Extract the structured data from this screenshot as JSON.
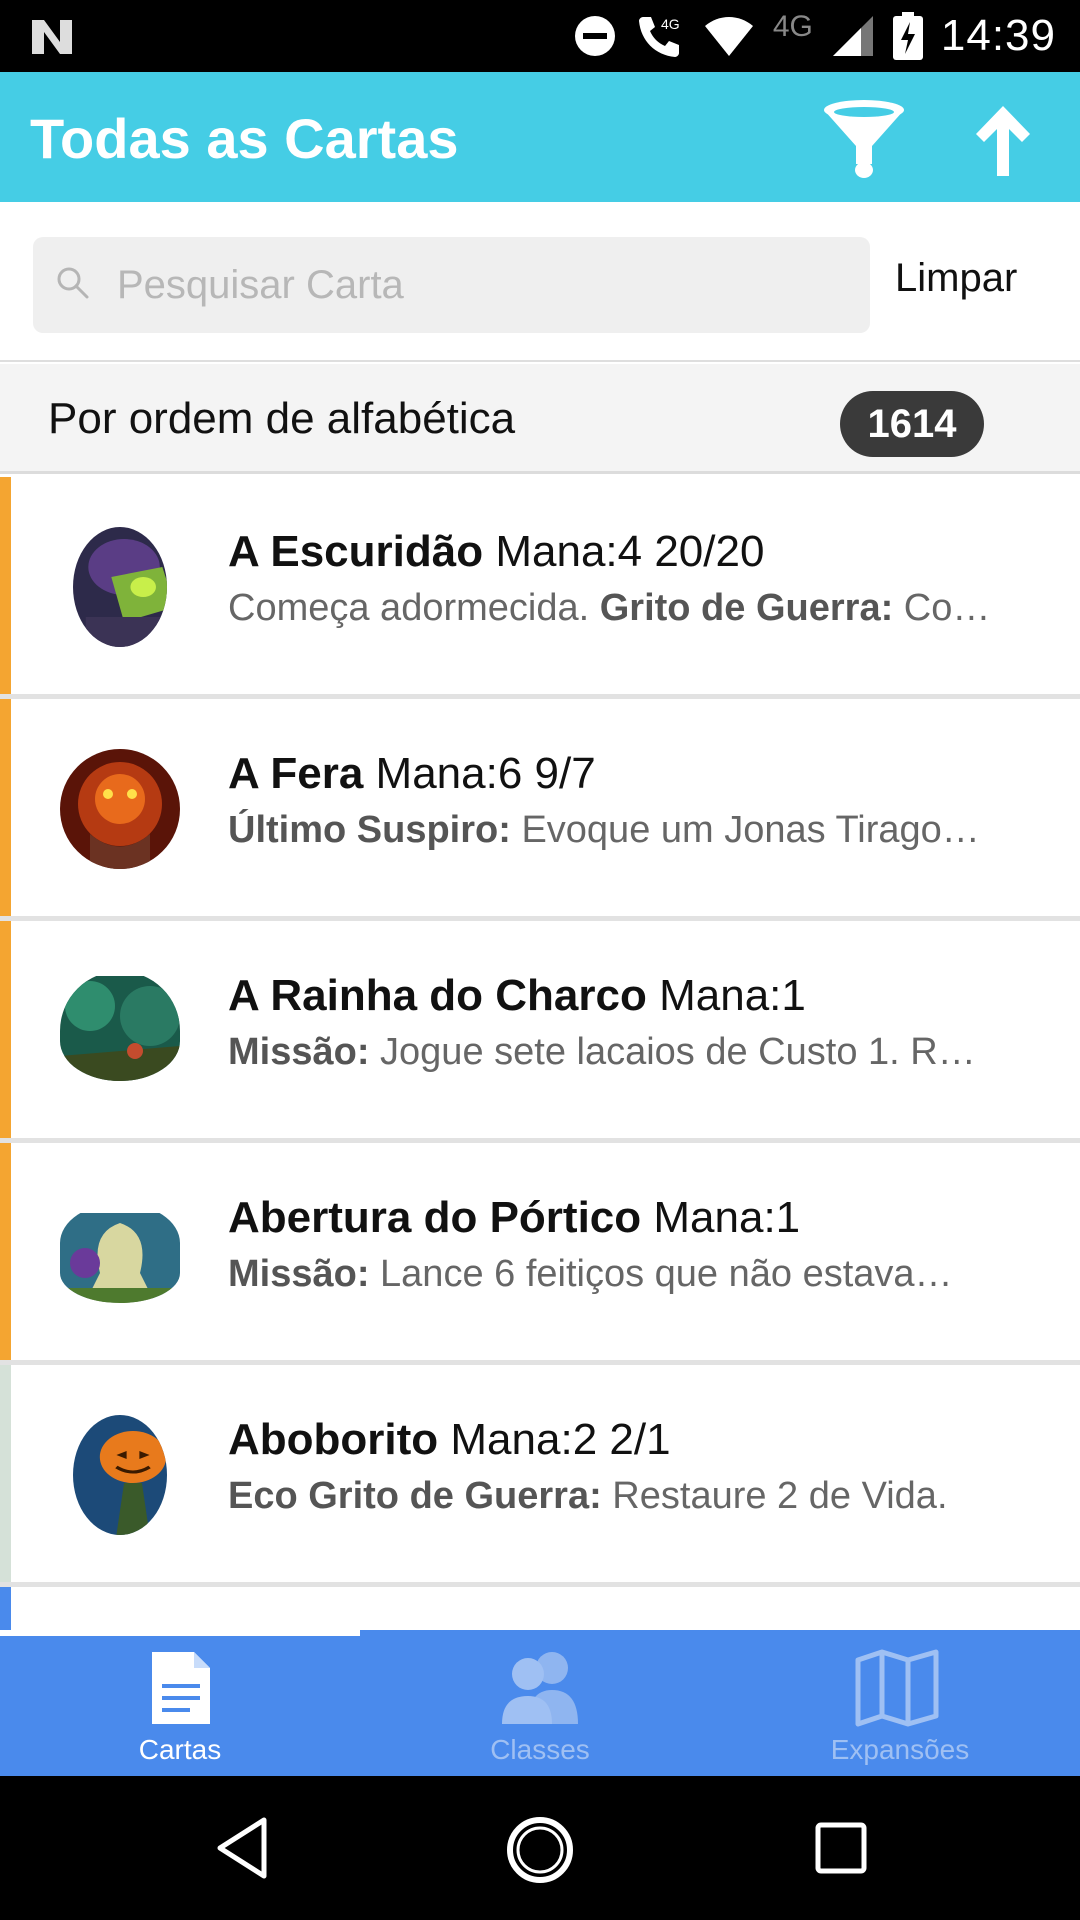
{
  "status_bar": {
    "network_label": "4G",
    "call_badge": "4G",
    "time": "14:39"
  },
  "app_bar": {
    "title": "Todas as Cartas",
    "icons": [
      "filter-icon",
      "arrow-up-icon"
    ]
  },
  "search": {
    "placeholder": "Pesquisar Carta",
    "value": "",
    "clear_label": "Limpar"
  },
  "sort_header": {
    "label": "Por ordem de alfabética",
    "count": "1614"
  },
  "cards": [
    {
      "name": "A Escuridão",
      "stats": "Mana:4 20/20",
      "desc_bold": "",
      "desc_prefix": "Começa adormecida. ",
      "desc_bold2": "Grito de Guerra:",
      "desc_rest": " Co…",
      "stripe_color": "#f4a531"
    },
    {
      "name": "A Fera",
      "stats": "Mana:6 9/7",
      "desc_bold": "Último Suspiro:",
      "desc_prefix": "",
      "desc_bold2": "",
      "desc_rest": " Evoque um Jonas Tirago…",
      "stripe_color": "#f4a531"
    },
    {
      "name": "A Rainha do Charco",
      "stats": "Mana:1",
      "desc_bold": "Missão:",
      "desc_prefix": "",
      "desc_bold2": "",
      "desc_rest": " Jogue sete lacaios de Custo 1. R…",
      "stripe_color": "#f4a531"
    },
    {
      "name": "Abertura do Pórtico",
      "stats": "Mana:1",
      "desc_bold": "Missão:",
      "desc_prefix": "",
      "desc_bold2": "",
      "desc_rest": " Lance 6 feitiços que não estava…",
      "stripe_color": "#f4a531"
    },
    {
      "name": "Aboborito",
      "stats": "Mana:2 2/1",
      "desc_bold": "Eco Grito de Guerra:",
      "desc_prefix": "",
      "desc_bold2": "",
      "desc_rest": " Restaure 2 de Vida.",
      "stripe_color": "#d5e1d8"
    }
  ],
  "bottom_nav": {
    "tabs": [
      {
        "label": "Cartas",
        "icon": "document-icon",
        "active": true
      },
      {
        "label": "Classes",
        "icon": "users-icon",
        "active": false
      },
      {
        "label": "Expansões",
        "icon": "map-icon",
        "active": false
      }
    ]
  },
  "colors": {
    "app_bar": "#45cde5",
    "bottom_nav": "#4a8aec",
    "stripe_legendary": "#f4a531",
    "stripe_common": "#d5e1d8",
    "count_badge": "#3a3a3a"
  }
}
